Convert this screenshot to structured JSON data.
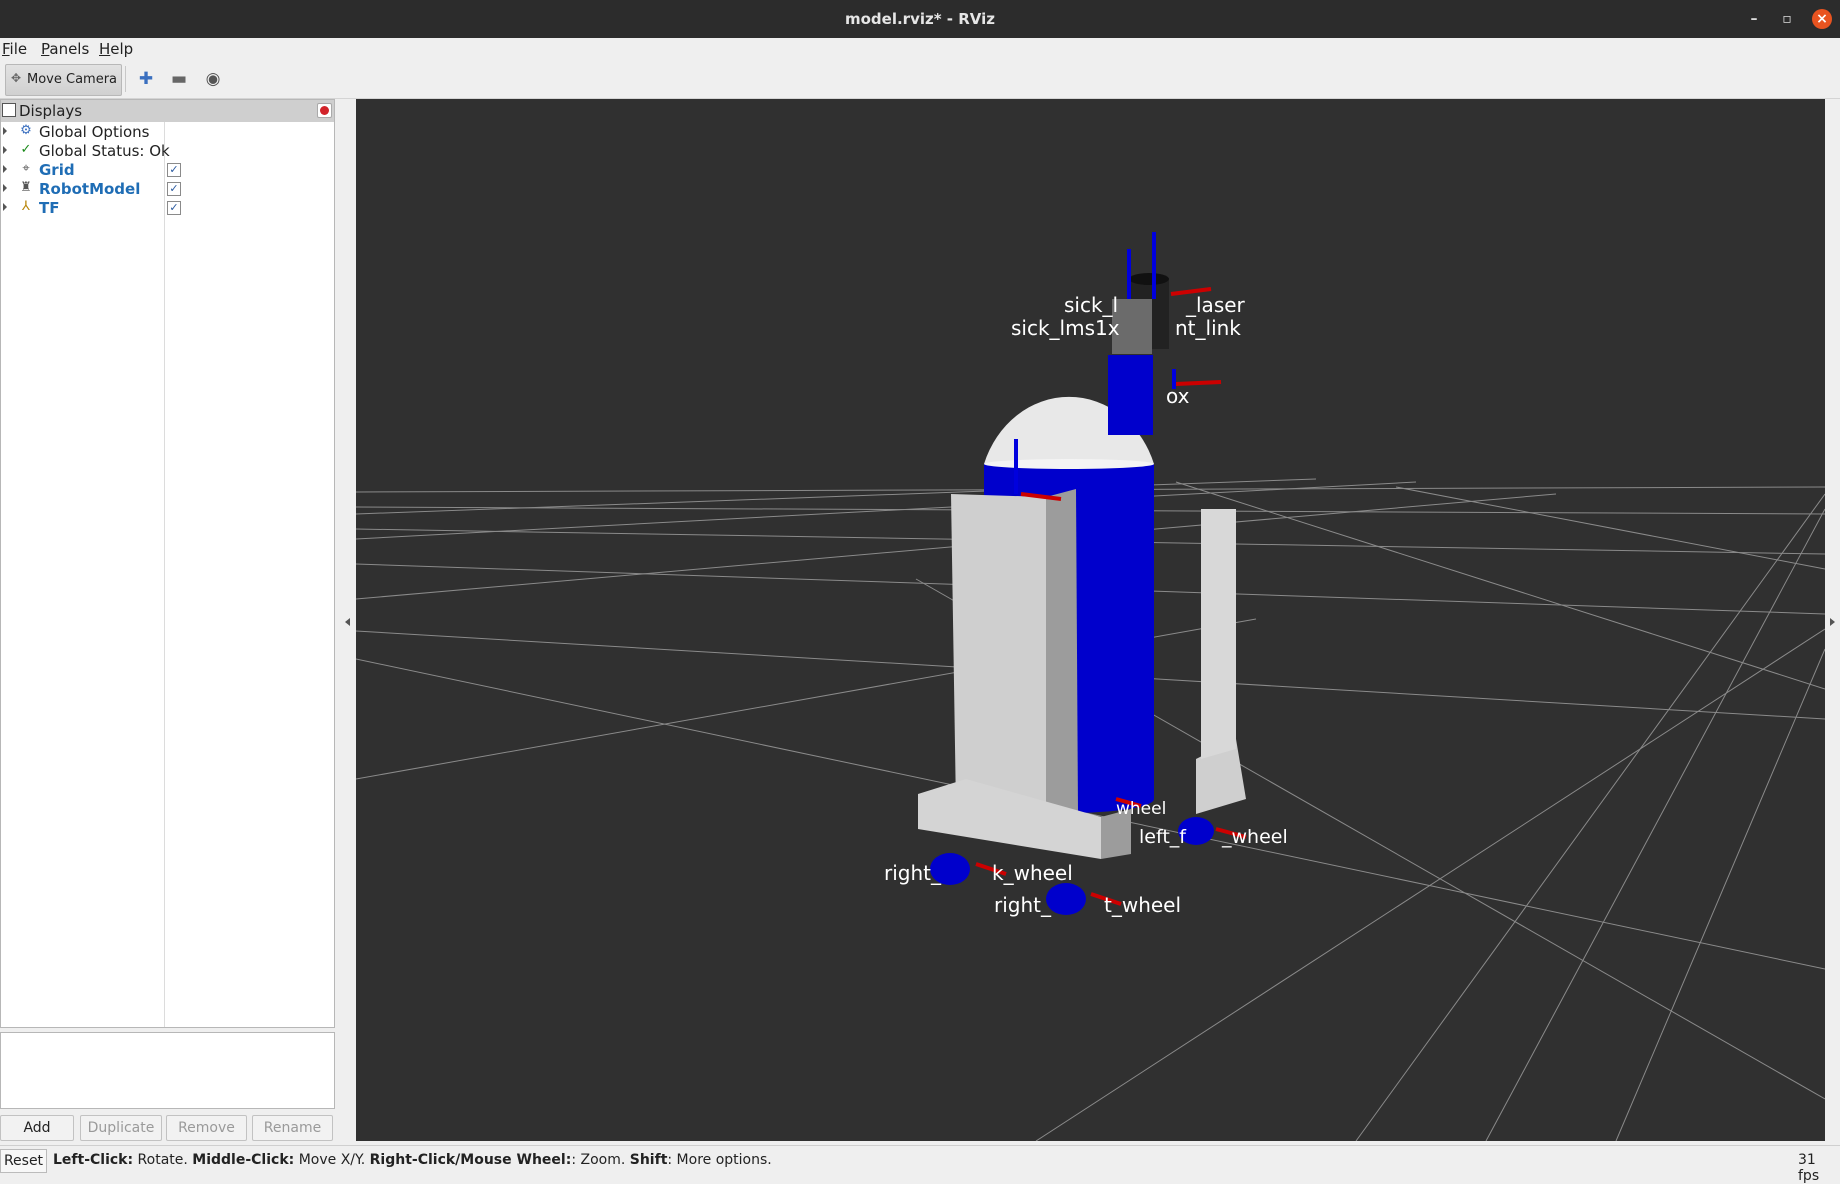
{
  "window": {
    "title": "model.rviz* - RViz",
    "min_label": "–",
    "max_label": "▫",
    "close_label": "×"
  },
  "menubar": [
    {
      "label": "File",
      "mnemonic": "F",
      "rest": "ile"
    },
    {
      "label": "Panels",
      "mnemonic": "P",
      "rest": "anels"
    },
    {
      "label": "Help",
      "mnemonic": "H",
      "rest": "elp"
    }
  ],
  "toolbar": {
    "move_camera_label": "Move Camera",
    "tools": [
      "plus-icon",
      "minus-icon",
      "eye-icon"
    ]
  },
  "displays": {
    "title": "Displays",
    "items": [
      {
        "label": "Global Options",
        "icon": "gear-icon",
        "checkbox": false,
        "bold": false
      },
      {
        "label": "Global Status: Ok",
        "icon": "check-icon",
        "checkbox": false,
        "bold": false
      },
      {
        "label": "Grid",
        "icon": "grid-icon",
        "checkbox": true,
        "checked": true,
        "bold": true
      },
      {
        "label": "RobotModel",
        "icon": "robot-icon",
        "checkbox": true,
        "checked": true,
        "bold": true
      },
      {
        "label": "TF",
        "icon": "tf-axes-icon",
        "checkbox": true,
        "checked": true,
        "bold": true
      }
    ],
    "buttons": {
      "add": "Add",
      "duplicate": "Duplicate",
      "remove": "Remove",
      "rename": "Rename"
    }
  },
  "viewport": {
    "background": "#303030",
    "frame_labels": [
      "sick_l",
      "_laser",
      "sick_lms1x",
      "nt_link",
      "ox",
      "wheel",
      "left_f",
      "_wheel",
      "right_",
      "k_wheel",
      "right_",
      "t_wheel"
    ]
  },
  "statusbar": {
    "reset": "Reset",
    "hint": [
      {
        "key": "Left-Click:",
        "text": " Rotate. "
      },
      {
        "key": "Middle-Click:",
        "text": " Move X/Y. "
      },
      {
        "key": "Right-Click/Mouse Wheel:",
        "text": ": Zoom. "
      },
      {
        "key": "Shift",
        "text": ": More options."
      }
    ],
    "fps": "31 fps"
  },
  "colors": {
    "robot_blue": "#0000cc",
    "robot_white": "#dcdcdc",
    "axis_red": "#cc0000",
    "accent_close": "#e95420"
  }
}
